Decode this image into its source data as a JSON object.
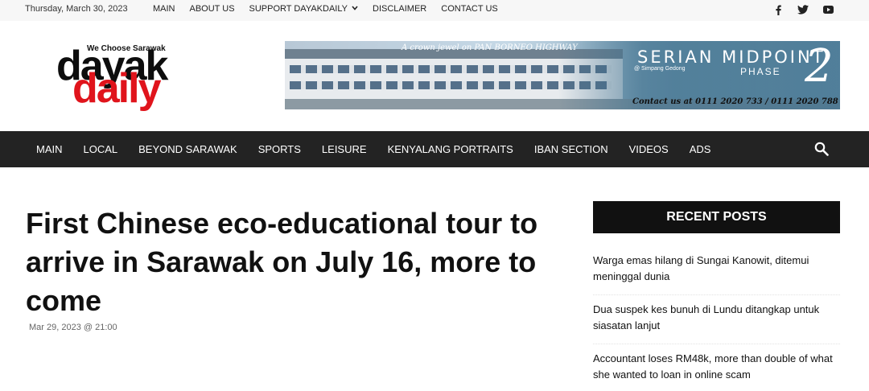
{
  "topbar": {
    "date": "Thursday, March 30, 2023",
    "nav": [
      {
        "label": "MAIN"
      },
      {
        "label": "ABOUT US"
      },
      {
        "label": "SUPPORT DAYAKDAILY"
      },
      {
        "label": "DISCLAIMER"
      },
      {
        "label": "CONTACT US"
      }
    ],
    "social_icons": [
      "facebook-icon",
      "twitter-icon",
      "youtube-icon"
    ]
  },
  "logo": {
    "tagline": "We Choose Sarawak",
    "word1": "dayak",
    "word2": "daily"
  },
  "banner": {
    "crown_text": "A crown jewel on PAN BORNEO HIGHWAY",
    "title": "SERIAN MIDPOINT",
    "subtitle": "@ Simpang Gedong",
    "phase": "PHASE",
    "phase_number": "2",
    "contact": "Contact us at 0111 2020 733 / 0111 2020 788"
  },
  "mainnav": {
    "links": [
      {
        "label": "MAIN"
      },
      {
        "label": "LOCAL"
      },
      {
        "label": "BEYOND SARAWAK"
      },
      {
        "label": "SPORTS"
      },
      {
        "label": "LEISURE"
      },
      {
        "label": "KENYALANG PORTRAITS"
      },
      {
        "label": "IBAN SECTION"
      },
      {
        "label": "VIDEOS"
      },
      {
        "label": "ADS"
      }
    ],
    "search_icon": "search-icon"
  },
  "article": {
    "title": "First Chinese eco-educational tour to arrive in Sarawak on July 16, more to come",
    "meta": "Mar 29, 2023 @ 21:00"
  },
  "sidebar": {
    "heading": "RECENT POSTS",
    "posts": [
      {
        "title": "Warga emas hilang di Sungai Kanowit, ditemui meninggal dunia"
      },
      {
        "title": "Dua suspek kes bunuh di Lundu ditangkap untuk siasatan lanjut"
      },
      {
        "title": "Accountant loses RM48k, more than double of what she wanted to loan in online scam"
      }
    ]
  },
  "colors": {
    "nav_bg": "#232323",
    "logo_red": "#e0141c",
    "heading_bg": "#111111"
  }
}
